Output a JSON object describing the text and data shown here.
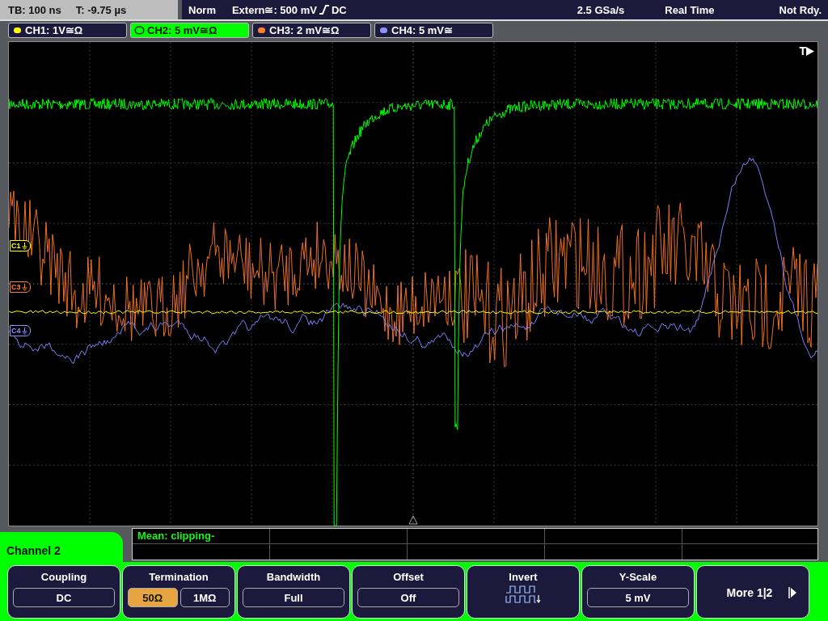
{
  "header": {
    "timebase": "TB: 100 ns",
    "trigger_time": "T: -9.75 µs",
    "mode": "Norm",
    "trigger_source": "Extern≅: 500 mV",
    "trigger_coupling": "DC",
    "sample_rate": "2.5 GSa/s",
    "acquisition": "Real Time",
    "status": "Not Rdy."
  },
  "channels": [
    {
      "label": "CH1: 1V≅Ω",
      "color": "#ffff00",
      "selected": false
    },
    {
      "label": "CH2: 5 mV≅Ω",
      "color": "#00ff00",
      "selected": true
    },
    {
      "label": "CH3: 2 mV≅Ω",
      "color": "#ff8030",
      "selected": false
    },
    {
      "label": "CH4: 5 mV≅",
      "color": "#9090ff",
      "selected": false
    }
  ],
  "plot": {
    "trigger_label": "T",
    "markers": [
      {
        "label": "C1",
        "color": "#ffff00"
      },
      {
        "label": "C3",
        "color": "#ff8030"
      },
      {
        "label": "C4",
        "color": "#9090ff"
      }
    ]
  },
  "measurement": {
    "text": "Mean: clipping-"
  },
  "menu": {
    "title": "Channel 2",
    "softkeys": [
      {
        "kind": "value",
        "label": "Coupling",
        "value": "DC"
      },
      {
        "kind": "options",
        "label": "Termination",
        "options": [
          {
            "label": "50Ω",
            "selected": true
          },
          {
            "label": "1MΩ",
            "selected": false
          }
        ]
      },
      {
        "kind": "value",
        "label": "Bandwidth",
        "value": "Full"
      },
      {
        "kind": "value",
        "label": "Offset",
        "value": "Off"
      },
      {
        "kind": "icon",
        "label": "Invert"
      },
      {
        "kind": "value",
        "label": "Y-Scale",
        "value": "5 mV"
      },
      {
        "kind": "next",
        "label": "More 1|2"
      }
    ]
  }
}
